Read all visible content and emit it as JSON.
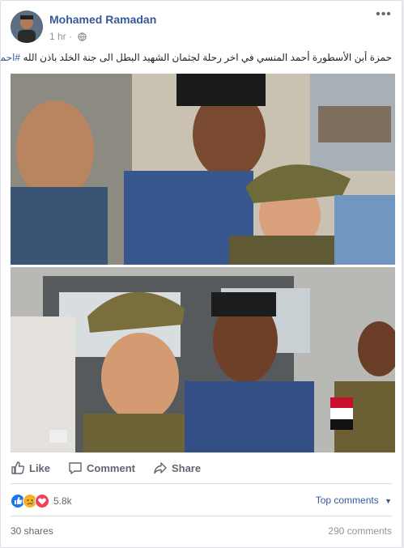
{
  "post": {
    "author": "Mohamed Ramadan",
    "time": "1 hr",
    "text": "حمزة أبن الأسطورة أحمد المنسي في اخر رحلة لجثمان الشهيد البطل الى جنة الخلد باذن الله",
    "hashtag": "#احمد_المنسي"
  },
  "actions": {
    "like": "Like",
    "comment": "Comment",
    "share": "Share"
  },
  "reactions": {
    "count": "5.8k",
    "types": [
      "like-icon",
      "sad-icon",
      "love-icon"
    ],
    "sort_label": "Top comments"
  },
  "footer": {
    "shares": "30 shares",
    "comments": "290 comments"
  },
  "colors": {
    "link": "#365899",
    "like_blue": "#1877f2",
    "love_red": "#f33e58"
  }
}
